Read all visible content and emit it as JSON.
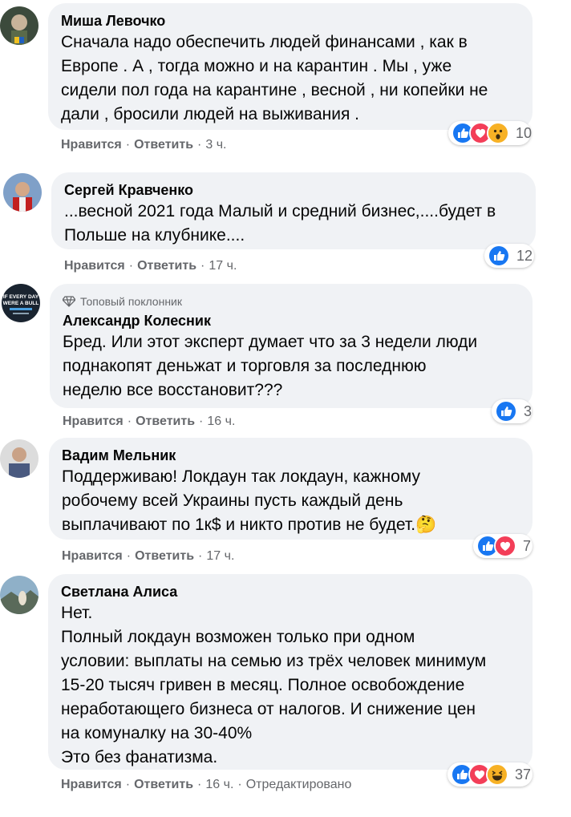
{
  "labels": {
    "like": "Нравится",
    "reply": "Ответить",
    "sep": "·"
  },
  "comments": [
    {
      "author": "Миша Левочко",
      "text": "Сначала надо обеспечить людей финансами , как в\nЕвропе . А , тогда можно и на карантин . Мы , уже\nсидели пол года на карантине , весной , ни копейки не\nдали , бросили людей на выживания .",
      "time": "3 ч.",
      "reactions": {
        "icons": [
          "like-icon",
          "love-icon",
          "wow-icon"
        ],
        "count": "10"
      }
    },
    {
      "author": "Сергей Кравченко",
      "text": "...весной 2021 года Малый и средний бизнес,....будет в\nПольше на клубнике....",
      "time": "17 ч.",
      "reactions": {
        "icons": [
          "like-icon"
        ],
        "count": "12"
      }
    },
    {
      "badge": "Топовый поклонник",
      "author": "Александр Колесник",
      "text": "Бред. Или этот эксперт думает что за 3 недели люди\nподнакопят деньжат и торговля за последнюю\nнеделю все восстановит???",
      "time": "16 ч.",
      "reactions": {
        "icons": [
          "like-icon"
        ],
        "count": "3"
      },
      "avatar_text": "IF EVERY DAY WERE A BULL"
    },
    {
      "author": "Вадим Мельник",
      "text": "Поддерживаю! Локдаун так локдаун, кажному\nробочему всей Украины пусть каждый день\nвыплачивают по 1к$ и никто против не будет.🤔",
      "time": "17 ч.",
      "reactions": {
        "icons": [
          "like-icon",
          "love-icon"
        ],
        "count": "7"
      }
    },
    {
      "author": "Светлана Алиса",
      "text": "Нет.\nПолный локдаун возможен только при одном\nусловии: выплаты на семью из трёх человек минимум\n15-20 тысяч гривен в месяц. Полное освобождение\nнеработающего бизнеса от налогов. И снижение цен\nна комуналку на 30-40%\nЭто без фанатизма.",
      "time": "16 ч.",
      "edited": "Отредактировано",
      "reactions": {
        "icons": [
          "like-icon",
          "love-icon",
          "haha-icon"
        ],
        "count": "37"
      }
    }
  ],
  "colors": {
    "bubble": "#f0f2f5",
    "like": "#1877f2",
    "love": "#f33e58",
    "emoji_yellow": "#f7b125",
    "meta_text": "#65676b"
  }
}
